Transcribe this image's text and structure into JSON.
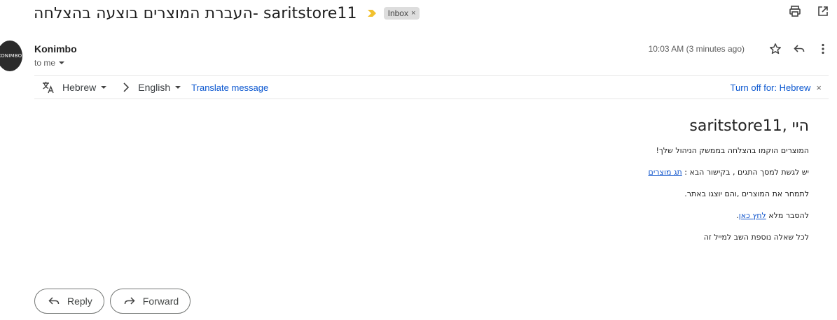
{
  "subject": {
    "text": "העברת המוצרים בוצעה בהצלחה- saritstore11",
    "label": "Inbox",
    "label_close": "×",
    "importance_color": "#f2c12e"
  },
  "sender": {
    "avatar_text": "KONIMBO",
    "name": "Konimbo",
    "to": "to me",
    "timestamp": "10:03 AM (3 minutes ago)"
  },
  "translate": {
    "from_lang": "Hebrew",
    "to_lang": "English",
    "translate_link": "Translate message",
    "turn_off": "Turn off for: Hebrew",
    "turn_off_close": "×"
  },
  "message": {
    "greeting": "היי ,saritstore11",
    "line1": "המוצרים הוקמו בהצלחה בממשק הניהול שלך!",
    "line2_text": "יש לגשת למסך התגים , בקישור הבא : ",
    "line2_link": "תג מוצרים",
    "line3": "לתמחר את המוצרים ,והם יוצגו באתר.",
    "line4_text": "להסבר מלא ",
    "line4_link": "לחץ כאן",
    "line4_end": ".",
    "line5": "לכל שאלה נוספת השב למייל זה"
  },
  "actions": {
    "reply": "Reply",
    "forward": "Forward"
  },
  "colors": {
    "link": "#0b57d0",
    "body_link": "#1155cc"
  }
}
